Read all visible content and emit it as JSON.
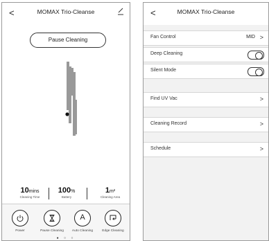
{
  "left": {
    "back": "<",
    "title": "MOMAX Trio-Cleanse",
    "pause_button": "Pause Cleaning",
    "stats": [
      {
        "value": "10",
        "unit": "mins",
        "label": "Cleaning Time"
      },
      {
        "value": "100",
        "unit": "%",
        "label": "Battery"
      },
      {
        "value": "1",
        "unit": "m²",
        "label": "Cleaning Area"
      }
    ],
    "buttons": [
      {
        "label": "Power",
        "icon": "power-icon"
      },
      {
        "label": "Pause Cleaning",
        "icon": "hourglass-icon"
      },
      {
        "label": "Auto Cleaning",
        "icon": "auto-a-icon"
      },
      {
        "label": "Edge Cleaning",
        "icon": "edge-corner-icon"
      }
    ],
    "dots": "● ○ ○"
  },
  "right": {
    "back": "<",
    "title": "MOMAX Trio-Cleanse",
    "rows": {
      "fan_control": {
        "label": "Fan Control",
        "value": "MID"
      },
      "deep_cleaning": {
        "label": "Deep Cleaning",
        "on": true
      },
      "silent_mode": {
        "label": "Silent Mode",
        "on": true
      },
      "find_uv_vac": {
        "label": "Find UV Vac"
      },
      "cleaning_record": {
        "label": "Cleaning Record"
      },
      "schedule": {
        "label": "Schedule"
      }
    },
    "chevron": ">"
  }
}
